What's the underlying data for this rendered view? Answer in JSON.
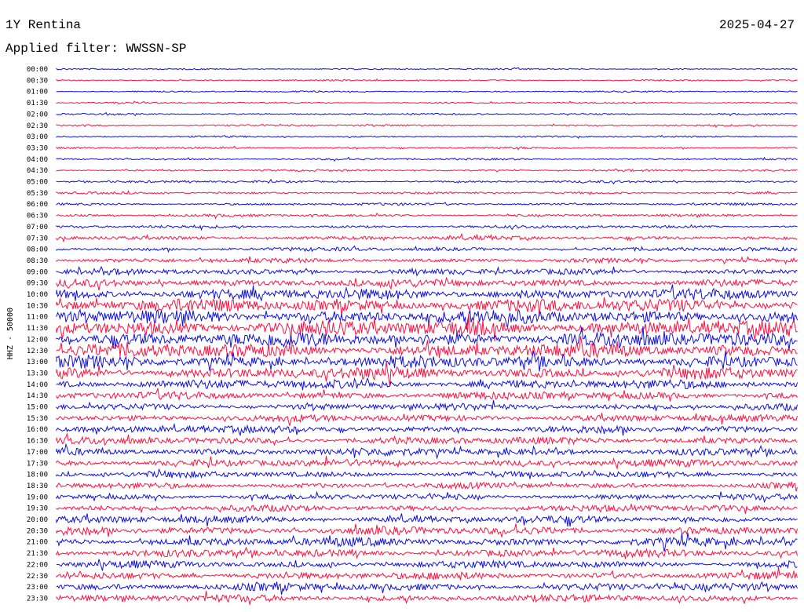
{
  "header": {
    "station": "1Y Rentina",
    "date": "2025-04-27",
    "filter_label": "Applied filter: WWSSN-SP"
  },
  "chart_data": {
    "type": "helicorder",
    "title": "1Y Rentina",
    "subtitle": "Applied filter: WWSSN-SP",
    "date": "2025-04-27",
    "ylabel": "HHZ - 50000",
    "row_labels": [
      "00:00",
      "00:30",
      "01:00",
      "01:30",
      "02:00",
      "02:30",
      "03:00",
      "03:30",
      "04:00",
      "04:30",
      "05:00",
      "05:30",
      "06:00",
      "06:30",
      "07:00",
      "07:30",
      "08:00",
      "08:30",
      "09:00",
      "09:30",
      "10:00",
      "10:30",
      "11:00",
      "11:30",
      "12:00",
      "12:30",
      "13:00",
      "13:30",
      "14:00",
      "14:30",
      "15:00",
      "15:30",
      "16:00",
      "16:30",
      "17:00",
      "17:30",
      "18:00",
      "18:30",
      "19:00",
      "19:30",
      "20:00",
      "20:30",
      "21:00",
      "21:30",
      "22:00",
      "22:30",
      "23:00",
      "23:30"
    ],
    "row_colors": [
      "#1010e0",
      "#ff1040"
    ],
    "noise_amplitude_level": [
      0.6,
      0.6,
      0.6,
      0.6,
      0.7,
      0.7,
      0.7,
      0.8,
      0.8,
      0.8,
      0.9,
      0.9,
      1.0,
      1.1,
      1.2,
      1.6,
      1.6,
      1.8,
      2.4,
      3.2,
      4.5,
      5.5,
      6.0,
      6.5,
      6.2,
      5.8,
      5.2,
      4.8,
      3.8,
      3.2,
      2.8,
      2.8,
      3.0,
      3.0,
      3.2,
      3.0,
      2.6,
      2.4,
      2.4,
      2.6,
      3.0,
      3.4,
      3.6,
      3.2,
      3.0,
      3.0,
      3.2,
      3.0
    ]
  }
}
